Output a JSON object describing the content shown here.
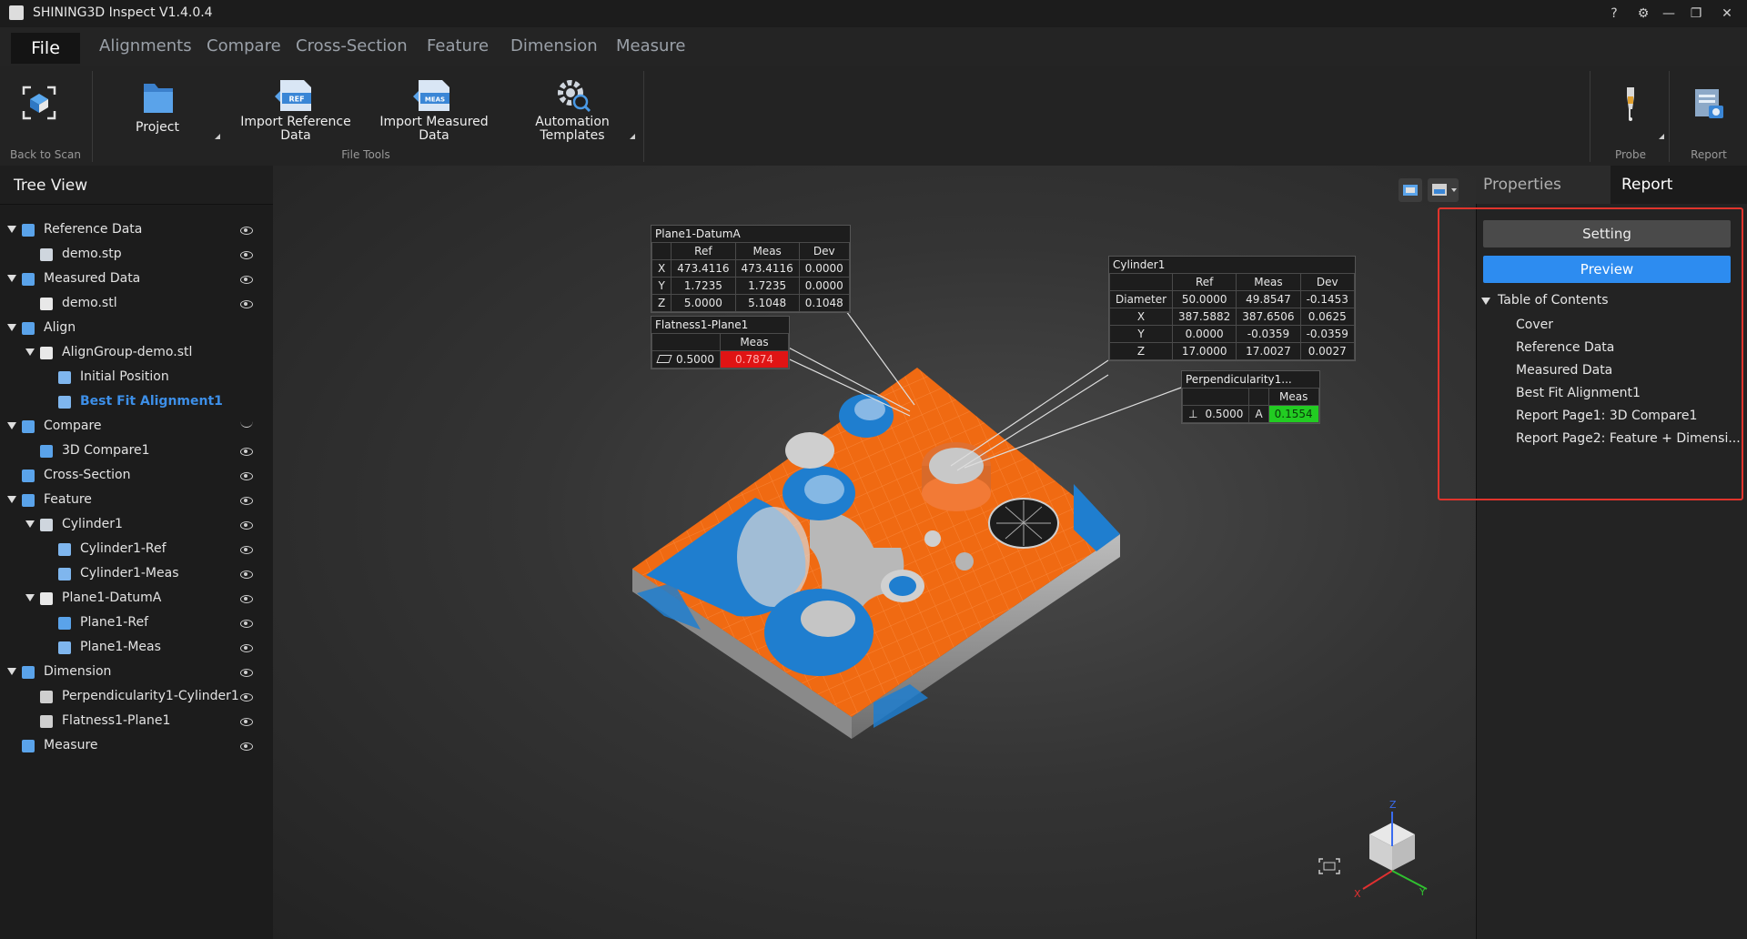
{
  "app": {
    "title": "SHINING3D Inspect V1.4.0.4"
  },
  "menu": {
    "file": "File",
    "items": [
      "Alignments",
      "Compare",
      "Cross-Section",
      "Feature",
      "Dimension",
      "Measure"
    ]
  },
  "ribbon": {
    "back_to_scan": "Back to Scan",
    "project": "Project",
    "import_ref_line1": "Import Reference",
    "import_ref_line2": "Data",
    "import_meas_line1": "Import Measured",
    "import_meas_line2": "Data",
    "automation_line1": "Automation",
    "automation_line2": "Templates",
    "group_file_tools": "File Tools",
    "probe": "Probe",
    "report": "Report",
    "ref_badge": "REF",
    "meas_badge": "MEAS"
  },
  "tree": {
    "title": "Tree View",
    "items": [
      {
        "label": "Reference Data",
        "icon": "reference-data-icon",
        "selected": false,
        "eye": "open"
      },
      {
        "label": "demo.stp",
        "icon": "cube-icon",
        "selected": false,
        "eye": "open"
      },
      {
        "label": "Measured Data",
        "icon": "measured-data-icon",
        "selected": false,
        "eye": "open"
      },
      {
        "label": "demo.stl",
        "icon": "point-cloud-icon",
        "selected": false,
        "eye": "open"
      },
      {
        "label": "Align",
        "icon": "align-icon",
        "selected": false,
        "eye": "none"
      },
      {
        "label": "AlignGroup-demo.stl",
        "icon": "folder-icon",
        "selected": false,
        "eye": "none"
      },
      {
        "label": "Initial Position",
        "icon": "initial-position-icon",
        "selected": false,
        "eye": "none"
      },
      {
        "label": "Best Fit Alignment1",
        "icon": "best-fit-icon",
        "selected": true,
        "eye": "none"
      },
      {
        "label": "Compare",
        "icon": "compare-icon",
        "selected": false,
        "eye": "closed"
      },
      {
        "label": "3D Compare1",
        "icon": "3d-compare-icon",
        "selected": false,
        "eye": "open"
      },
      {
        "label": "Cross-Section",
        "icon": "cross-section-icon",
        "selected": false,
        "eye": "open"
      },
      {
        "label": "Feature",
        "icon": "feature-icon",
        "selected": false,
        "eye": "open"
      },
      {
        "label": "Cylinder1",
        "icon": "cylinder-icon",
        "selected": false,
        "eye": "open"
      },
      {
        "label": "Cylinder1-Ref",
        "icon": "cylinder-ref-icon",
        "selected": false,
        "eye": "open"
      },
      {
        "label": "Cylinder1-Meas",
        "icon": "cylinder-meas-icon",
        "selected": false,
        "eye": "open"
      },
      {
        "label": "Plane1-DatumA",
        "icon": "plane-icon",
        "selected": false,
        "eye": "open"
      },
      {
        "label": "Plane1-Ref",
        "icon": "plane-ref-icon",
        "selected": false,
        "eye": "open"
      },
      {
        "label": "Plane1-Meas",
        "icon": "plane-meas-icon",
        "selected": false,
        "eye": "open"
      },
      {
        "label": "Dimension",
        "icon": "dimension-icon",
        "selected": false,
        "eye": "open"
      },
      {
        "label": "Perpendicularity1-Cylinder1",
        "icon": "perpendicularity-icon",
        "selected": false,
        "eye": "open"
      },
      {
        "label": "Flatness1-Plane1",
        "icon": "flatness-icon",
        "selected": false,
        "eye": "open"
      },
      {
        "label": "Measure",
        "icon": "measure-icon",
        "selected": false,
        "eye": "open"
      }
    ]
  },
  "annotations": {
    "plane1": {
      "title": "Plane1-DatumA",
      "headers": [
        "Ref",
        "Meas",
        "Dev"
      ],
      "rows": [
        [
          "X",
          "473.4116",
          "473.4116",
          "0.0000"
        ],
        [
          "Y",
          "1.7235",
          "1.7235",
          "0.0000"
        ],
        [
          "Z",
          "5.0000",
          "5.1048",
          "0.1048"
        ]
      ]
    },
    "flatness": {
      "title": "Flatness1-Plane1",
      "header": "Meas",
      "tolerance": "0.5000",
      "value": "0.7874",
      "value_color": "#e01414"
    },
    "cylinder": {
      "title": "Cylinder1",
      "headers": [
        "Ref",
        "Meas",
        "Dev"
      ],
      "rows": [
        [
          "Diameter",
          "50.0000",
          "49.8547",
          "-0.1453"
        ],
        [
          "X",
          "387.5882",
          "387.6506",
          "0.0625"
        ],
        [
          "Y",
          "0.0000",
          "-0.0359",
          "-0.0359"
        ],
        [
          "Z",
          "17.0000",
          "17.0027",
          "0.0027"
        ]
      ]
    },
    "perpendicularity": {
      "title": "Perpendicularity1...",
      "header": "Meas",
      "tolerance": "0.5000",
      "datum": "A",
      "value": "0.1554",
      "value_color": "#22cc22"
    }
  },
  "axes": {
    "x": "X",
    "y": "Y",
    "z": "Z"
  },
  "right_panel": {
    "tabs": [
      "Properties",
      "Report"
    ],
    "setting": "Setting",
    "preview": "Preview",
    "toc_title": "Table of Contents",
    "toc_items": [
      "Cover",
      "Reference Data",
      "Measured Data",
      "Best Fit Alignment1",
      "Report Page1: 3D Compare1",
      "Report Page2: Feature + Dimensi..."
    ]
  },
  "colors": {
    "accent": "#2d8cf0",
    "highlight_text": "#3d8fe8",
    "deviation_orange": "#f06a12",
    "deviation_blue": "#1f7ecf",
    "report_frame": "#e0342c"
  }
}
